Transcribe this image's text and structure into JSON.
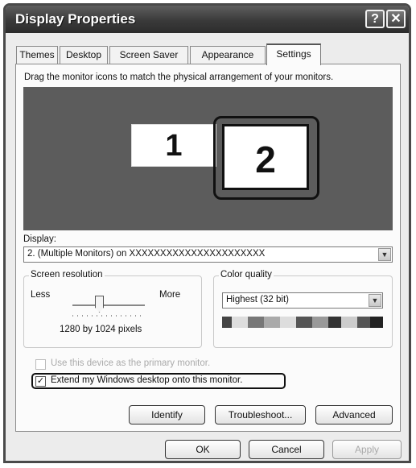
{
  "window": {
    "title": "Display Properties",
    "help_glyph": "?",
    "close_glyph": "✕"
  },
  "tabs": [
    {
      "label": "Themes"
    },
    {
      "label": "Desktop"
    },
    {
      "label": "Screen Saver"
    },
    {
      "label": "Appearance"
    },
    {
      "label": "Settings",
      "active": true
    }
  ],
  "settings": {
    "instruction": "Drag the monitor icons to match the physical arrangement of your monitors.",
    "monitors": [
      {
        "number": "1"
      },
      {
        "number": "2",
        "selected": true
      }
    ],
    "display_label": "Display:",
    "display_value": "2. (Multiple Monitors) on  XXXXXXXXXXXXXXXXXXXXXX",
    "resolution": {
      "title": "Screen resolution",
      "less": "Less",
      "more": "More",
      "value": "1280 by 1024 pixels"
    },
    "color_quality": {
      "title": "Color quality",
      "value": "Highest (32 bit)"
    },
    "primary_checkbox": {
      "label": "Use this device as the primary monitor.",
      "checked": false,
      "enabled": false
    },
    "extend_checkbox": {
      "label": "Extend my Windows desktop onto this monitor.",
      "checked": true,
      "enabled": true
    },
    "buttons": {
      "identify": "Identify",
      "troubleshoot": "Troubleshoot...",
      "advanced": "Advanced"
    }
  },
  "footer": {
    "ok": "OK",
    "cancel": "Cancel",
    "apply": "Apply"
  },
  "icons": {
    "dropdown": "▼",
    "check": "✓"
  }
}
